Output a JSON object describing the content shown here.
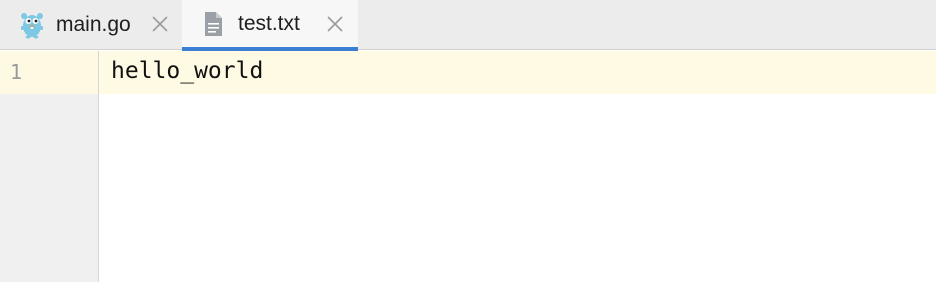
{
  "tabs": [
    {
      "label": "main.go",
      "icon": "gopher-icon",
      "active": false
    },
    {
      "label": "test.txt",
      "icon": "text-file-icon",
      "active": true
    }
  ],
  "editor": {
    "line_numbers": [
      "1"
    ],
    "lines": [
      "hello_world"
    ]
  },
  "colors": {
    "active_tab_underline": "#3b7fd4",
    "current_line_highlight": "#fffae3",
    "gopher_blue": "#7ec8e3"
  }
}
